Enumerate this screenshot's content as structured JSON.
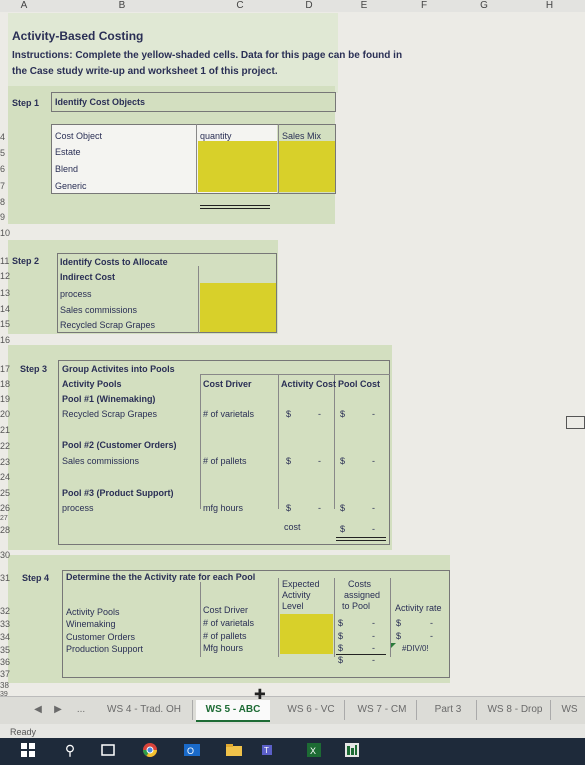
{
  "columns": [
    "A",
    "B",
    "C",
    "D",
    "E",
    "F",
    "G",
    "H"
  ],
  "title": "Activity-Based Costing",
  "instructions_line1": "Instructions: Complete the yellow-shaded cells.  Data for this page can be found in",
  "instructions_line2": "the Case study write-up and worksheet 1 of this project.",
  "step1": {
    "label": "Step 1",
    "header": "Identify Cost Objects",
    "col_object": "Cost Object",
    "col_quantity": "quantity",
    "col_mix": "Sales Mix",
    "rows": [
      "Estate",
      "Blend",
      "Generic"
    ]
  },
  "step2": {
    "label": "Step 2",
    "header": "Identify Costs to Allocate",
    "col": "Indirect Cost",
    "rows": [
      "process",
      "Sales commissions",
      "Recycled Scrap Grapes"
    ]
  },
  "step3": {
    "label": "Step 3",
    "header": "Group Activites into Pools",
    "col_pools": "Activity Pools",
    "col_driver": "Cost Driver",
    "col_activity": "Activity Cost",
    "col_pool": "Pool Cost",
    "pool1_title": "Pool #1 (Winemaking)",
    "pool1_item": "Recycled Scrap Grapes",
    "pool1_driver": "# of varietals",
    "pool2_title": "Pool #2 (Customer Orders)",
    "pool2_item": "Sales commissions",
    "pool2_driver": "# of pallets",
    "pool3_title": "Pool #3 (Product Support)",
    "pool3_item": "process",
    "pool3_driver": "mfg hours",
    "currency": "$",
    "dash": "-",
    "cost_label": "cost"
  },
  "step4": {
    "label": "Step 4",
    "header": "Determine the the Activity rate for each Pool",
    "col_pools": "Activity Pools",
    "col_driver": "Cost Driver",
    "col_expected_1": "Expected",
    "col_expected_2": "Activity",
    "col_expected_3": "Level",
    "col_costs_1": "Costs",
    "col_costs_2": "assigned",
    "col_costs_3": "to Pool",
    "col_rate": "Activity rate",
    "rows": [
      {
        "pool": "Winemaking",
        "driver": "# of varietals"
      },
      {
        "pool": "Customer Orders",
        "driver": "# of pallets"
      },
      {
        "pool": "Production Support",
        "driver": "Mfg hours"
      }
    ],
    "div0": "#DIV/0!"
  },
  "row_numbers": {
    "r4": "4",
    "r5": "5",
    "r6": "6",
    "r7": "7",
    "r8": "8",
    "r9": "9",
    "r10": "10",
    "r11": "11",
    "r12": "12",
    "r13": "13",
    "r14": "14",
    "r15": "15",
    "r16": "16",
    "r17": "17",
    "r18": "18",
    "r19": "19",
    "r20": "20",
    "r21": "21",
    "r22": "22",
    "r23": "23",
    "r24": "24",
    "r25": "25",
    "r26": "26",
    "r27": "27",
    "r28": "28",
    "r30": "30",
    "r31": "31",
    "r32": "32",
    "r33": "33",
    "r34": "34",
    "r35": "35",
    "r36": "36",
    "r37": "37",
    "r38": "38",
    "r39": "39"
  },
  "tabs": {
    "more": "...",
    "ws4": "WS 4 - Trad. OH",
    "ws5": "WS 5 - ABC",
    "ws6": "WS 6 - VC",
    "ws7": "WS 7 - CM",
    "part3": "Part 3",
    "ws8": "WS 8 - Drop",
    "ws9": "WS"
  },
  "status": "Ready",
  "colors": {
    "yellow": "#d8d02a",
    "green": "#d3dfc0",
    "text": "#2a2f55"
  }
}
